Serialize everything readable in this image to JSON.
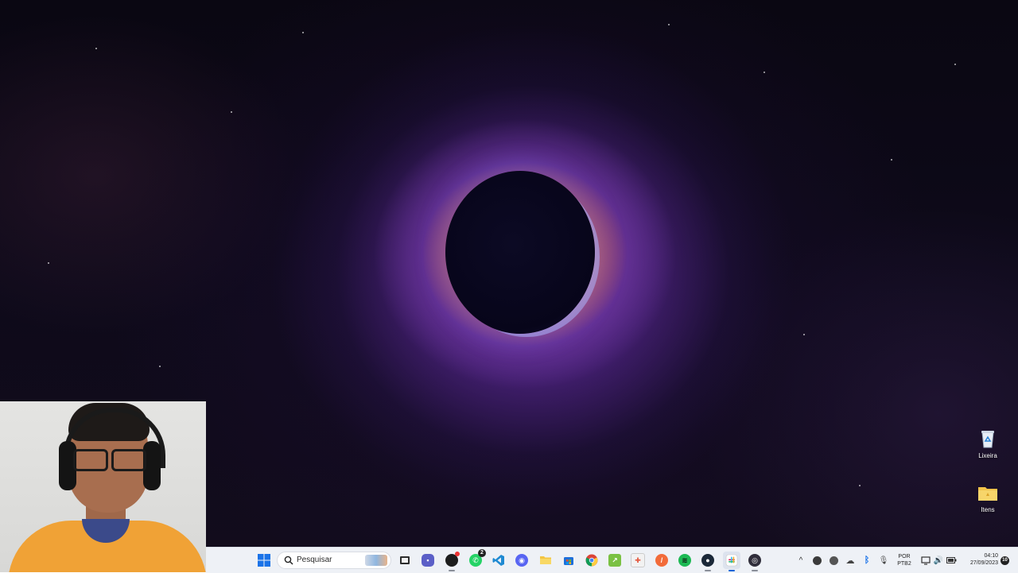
{
  "desktop": {
    "icons": [
      {
        "label": "Lixeira",
        "icon": "recycle-bin-icon"
      },
      {
        "label": "Itens",
        "icon": "folder-icon"
      }
    ]
  },
  "taskbar": {
    "search_placeholder": "Pesquisar",
    "apps": [
      {
        "name": "start",
        "icon": "windows-start-icon"
      },
      {
        "name": "task-view",
        "icon": "task-view-icon"
      },
      {
        "name": "chat",
        "icon": "chat-icon"
      },
      {
        "name": "browser-ext",
        "icon": "browser-icon"
      },
      {
        "name": "whatsapp",
        "icon": "whatsapp-icon",
        "badge": "2"
      },
      {
        "name": "vscode",
        "icon": "vscode-icon"
      },
      {
        "name": "discord",
        "icon": "discord-icon"
      },
      {
        "name": "file-explorer",
        "icon": "folder-icon"
      },
      {
        "name": "store",
        "icon": "store-icon"
      },
      {
        "name": "chrome",
        "icon": "chrome-icon"
      },
      {
        "name": "spreadsheet",
        "icon": "spreadsheet-icon"
      },
      {
        "name": "snipping",
        "icon": "snipping-icon"
      },
      {
        "name": "brave",
        "icon": "pen-icon"
      },
      {
        "name": "spotify",
        "icon": "spotify-icon"
      },
      {
        "name": "steam",
        "icon": "steam-icon"
      },
      {
        "name": "slack",
        "icon": "slack-icon"
      },
      {
        "name": "obs",
        "icon": "obs-icon"
      }
    ],
    "tray": {
      "language_top": "POR",
      "language_bottom": "PTB2",
      "time": "04:10",
      "date": "27/09/2023",
      "notification_count": "10"
    }
  },
  "colors": {
    "taskbar_bg": "#eef1f6",
    "accent_blue": "#0a64d8",
    "shirt": "#f0a236"
  }
}
